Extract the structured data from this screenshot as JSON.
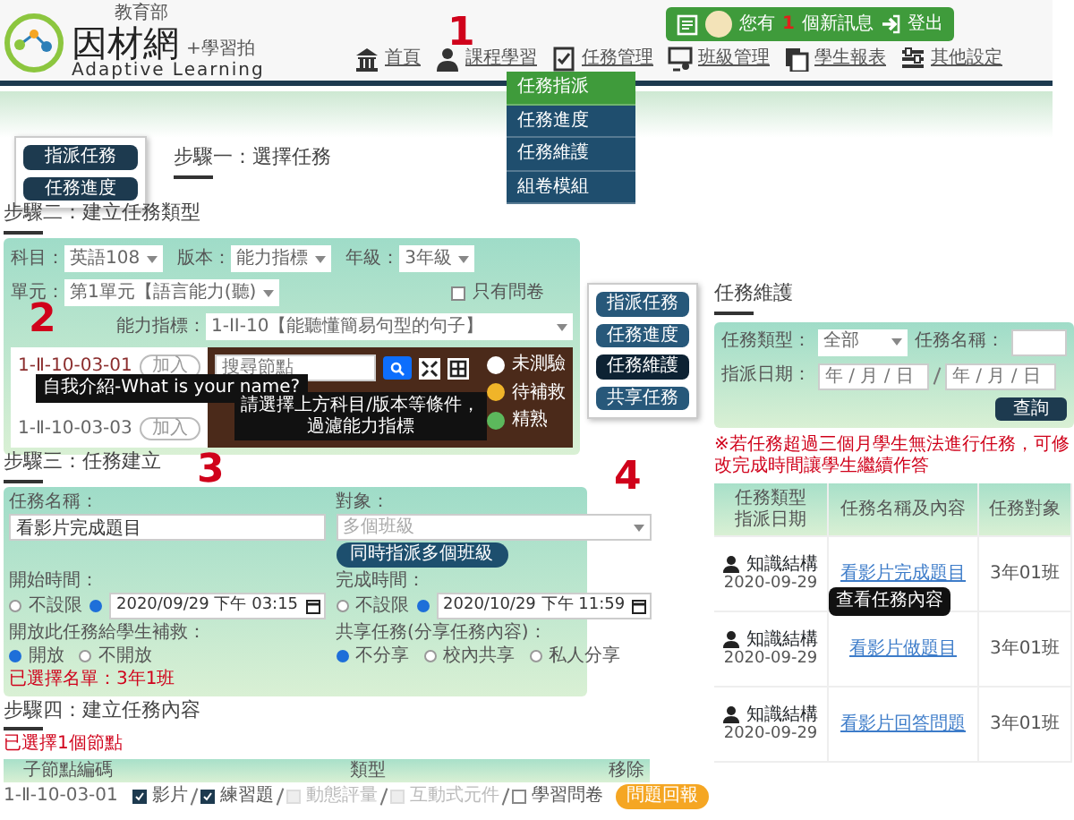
{
  "header": {
    "logo": {
      "ministry": "教育部",
      "name": "因材網",
      "tagline": "+學習拍",
      "subtitle": "Adaptive Learning"
    },
    "user_bar": {
      "prefix": "您有",
      "count": "1",
      "suffix": "個新訊息",
      "logout": "登出"
    },
    "nav": [
      {
        "kind": "home",
        "label": "首頁"
      },
      {
        "kind": "course",
        "label": "課程學習"
      },
      {
        "kind": "task",
        "label": "任務管理"
      },
      {
        "kind": "class",
        "label": "班級管理"
      },
      {
        "kind": "report",
        "label": "學生報表"
      },
      {
        "kind": "settings",
        "label": "其他設定"
      }
    ],
    "dropdown": [
      {
        "label": "任務指派",
        "selected": true
      },
      {
        "label": "任務進度",
        "selected": false
      },
      {
        "label": "任務維護",
        "selected": false
      },
      {
        "label": "組卷模組",
        "selected": false
      }
    ],
    "callout": "1"
  },
  "step1": {
    "title": "步驟一：選擇任務",
    "sidebar": [
      "指派任務",
      "任務進度"
    ]
  },
  "step2": {
    "title": "步驟二：建立任務類型",
    "callout": "2",
    "filters": [
      {
        "label": "科目：",
        "value": "英語108"
      },
      {
        "label": "版本：",
        "value": "能力指標"
      },
      {
        "label": "年級：",
        "value": "3年級"
      },
      {
        "label": "單元：",
        "value": "第1單元【語言能力(聽)"
      }
    ],
    "indicator": {
      "label": "能力指標：",
      "value": "1-II-10【能聽懂簡易句型的句子】"
    },
    "survey_only": {
      "label": "只有問卷",
      "checked": false
    },
    "nodes": [
      {
        "code": "1-Ⅱ-10-03-01",
        "button": "加入",
        "selected": true
      },
      {
        "code": "1-Ⅱ-10-03-03",
        "button": "加入",
        "selected": false
      }
    ],
    "tooltip": "自我介紹-What is your name?",
    "map": {
      "search_placeholder": "搜尋節點",
      "legend": [
        {
          "label": "未測驗",
          "color": "#ffffff"
        },
        {
          "label": "待補救",
          "color": "#f0b429"
        },
        {
          "label": "精熟",
          "color": "#5cb85c"
        }
      ],
      "message": [
        "請選擇上方科目/版本等條件，",
        "過濾能力指標"
      ]
    }
  },
  "side_menu": {
    "callout": "4",
    "items": [
      {
        "label": "指派任務",
        "selected": false
      },
      {
        "label": "任務進度",
        "selected": false
      },
      {
        "label": "任務維護",
        "selected": true
      },
      {
        "label": "共享任務",
        "selected": false
      }
    ]
  },
  "maintenance": {
    "title": "任務維護",
    "type": {
      "label": "任務類型：",
      "value": "全部"
    },
    "name": {
      "label": "任務名稱："
    },
    "date": {
      "label": "指派日期：",
      "from_placeholder": "年 / 月 / 日",
      "to_placeholder": "年 / 月 / 日"
    },
    "query_button": "查詢",
    "note": "※若任務超過三個月學生無法進行任務，可修改完成時間讓學生繼續作答",
    "table": {
      "columns": [
        [
          "任務類型",
          "指派日期"
        ],
        [
          "任務名稱及內容"
        ],
        [
          "任務對象"
        ]
      ],
      "rows": [
        {
          "type": "知識結構",
          "date": "2020-09-29",
          "name": "看影片完成題目",
          "target": "3年01班"
        },
        {
          "type": "知識結構",
          "date": "2020-09-29",
          "name": "看影片做題目",
          "target": "3年01班"
        },
        {
          "type": "知識結構",
          "date": "2020-09-29",
          "name": "看影片回答問題",
          "target": "3年01班"
        }
      ],
      "tooltip": "查看任務內容"
    }
  },
  "step3": {
    "title": "步驟三：任務建立",
    "callout": "3",
    "task_name": {
      "label": "任務名稱：",
      "value": "看影片完成題目"
    },
    "target": {
      "label": "對象：",
      "placeholder": "多個班級"
    },
    "multi_class_button": "同時指派多個班級",
    "start_time": {
      "label": "開始時間：",
      "unlimited": {
        "label": "不設限",
        "selected": false
      },
      "date": {
        "value": "2020/09/29 下午 03:15",
        "selected": true
      }
    },
    "end_time": {
      "label": "完成時間：",
      "unlimited": {
        "label": "不設限",
        "selected": false
      },
      "date": {
        "value": "2020/10/29 下午 11:59",
        "selected": true
      }
    },
    "remedial": {
      "label": "開放此任務給學生補救：",
      "options": [
        {
          "label": "開放",
          "selected": true
        },
        {
          "label": "不開放",
          "selected": false
        }
      ]
    },
    "share": {
      "label": "共享任務(分享任務內容)：",
      "options": [
        {
          "label": "不分享",
          "selected": true
        },
        {
          "label": "校內共享",
          "selected": false
        },
        {
          "label": "私人分享",
          "selected": false
        }
      ]
    },
    "selected_list": "已選擇名單：3年1班"
  },
  "step4": {
    "title": "步驟四：建立任務內容",
    "note": "已選擇1個節點",
    "columns": [
      "子節點編碼",
      "類型",
      "移除"
    ],
    "rows": [
      {
        "code": "1-Ⅱ-10-03-01",
        "types": [
          {
            "label": "影片",
            "checked": true,
            "disabled": false
          },
          {
            "label": "練習題",
            "checked": true,
            "disabled": false
          },
          {
            "label": "動態評量",
            "checked": false,
            "disabled": true
          },
          {
            "label": "互動式元件",
            "checked": false,
            "disabled": true
          },
          {
            "label": "學習問卷",
            "checked": false,
            "disabled": false
          }
        ]
      }
    ]
  },
  "report_button": "問題回報"
}
